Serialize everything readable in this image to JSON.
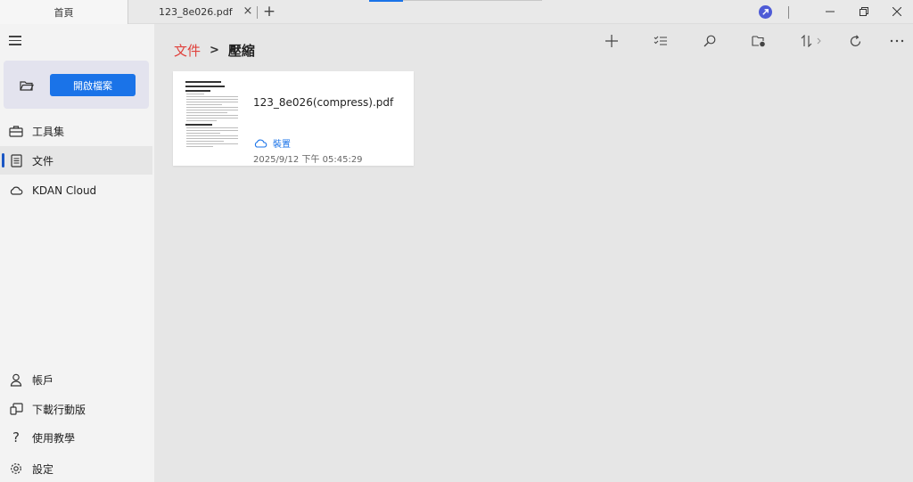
{
  "tabs": {
    "home_label": "首頁",
    "file_label": "123_8e026.pdf",
    "close_glyph": "×",
    "add_glyph": "+"
  },
  "window": {
    "badge_color": "#4e5bd6"
  },
  "sidebar": {
    "open_button_label": "開啟檔案",
    "items_top": [
      {
        "label": "工具集",
        "icon": "toolbox-icon"
      },
      {
        "label": "文件",
        "icon": "document-icon",
        "active": true
      },
      {
        "label": "KDAN Cloud",
        "icon": "cloud-icon"
      }
    ],
    "items_bottom": [
      {
        "label": "帳戶",
        "icon": "person-icon"
      },
      {
        "label": "下載行動版",
        "icon": "mobile-download-icon"
      },
      {
        "label": "使用教學",
        "icon": "help-icon"
      },
      {
        "label": "設定",
        "icon": "gear-icon"
      }
    ]
  },
  "breadcrumb": {
    "root": "文件",
    "separator": ">",
    "current": "壓縮"
  },
  "toolbar": {
    "icons": [
      "add-icon",
      "multi-select-icon",
      "search-icon",
      "folder-settings-icon",
      "sort-icon",
      "refresh-icon",
      "more-icon"
    ]
  },
  "file": {
    "name": "123_8e026(compress).pdf",
    "location": "裝置",
    "date": "2025/9/12 下午 05:45:29"
  },
  "colors": {
    "accent": "#1a73e8",
    "breadcrumb_root": "#e0413c",
    "sidebar_bg": "#f3f3f3",
    "main_bg": "#e6e6e6"
  }
}
